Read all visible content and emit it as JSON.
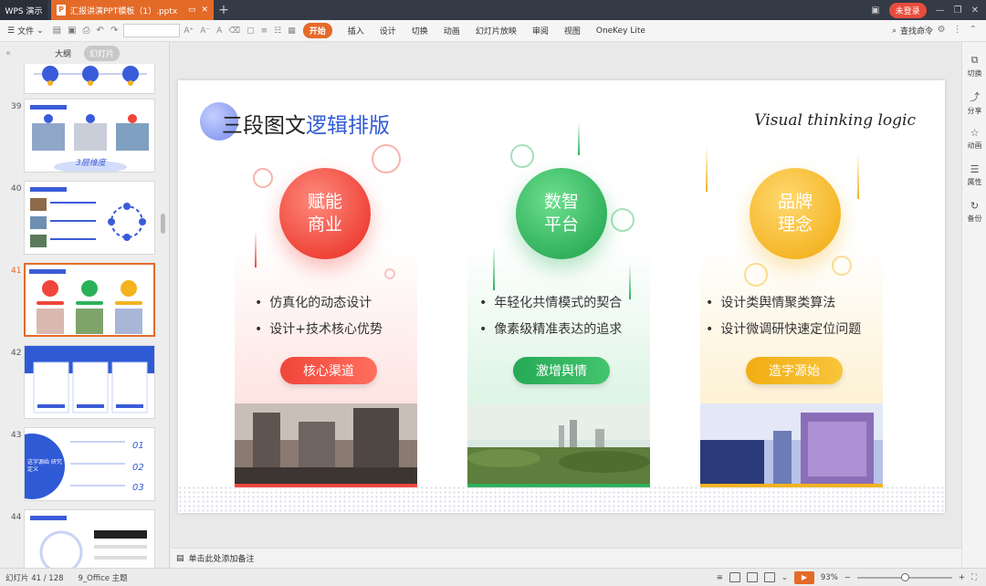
{
  "titlebar": {
    "app_name": "WPS 演示",
    "tab_name": "汇报讲演PPT模板（1）.pptx",
    "tab_badge": "P",
    "login_label": "未登录"
  },
  "toolbar": {
    "file_label": "文件",
    "ribbon_tabs": [
      "开始",
      "插入",
      "设计",
      "切换",
      "动画",
      "幻灯片放映",
      "审阅",
      "视图",
      "OneKey Lite"
    ],
    "active_tab": "开始",
    "search_label": "查找命令"
  },
  "left_panel": {
    "view_outline": "大纲",
    "view_slides": "幻灯片",
    "thumbs": [
      {
        "num": "39",
        "title_hint": "3层维度"
      },
      {
        "num": "40"
      },
      {
        "num": "41",
        "current": true
      },
      {
        "num": "42"
      },
      {
        "num": "43",
        "side_text": "这字源始 研究定义",
        "numbers": [
          "01",
          "02",
          "03"
        ]
      },
      {
        "num": "44"
      }
    ]
  },
  "slide": {
    "title_plain": "三段图文",
    "title_accent": "逻辑排版",
    "subtitle": "Visual thinking logic",
    "columns": [
      {
        "circle_line1": "赋能",
        "circle_line2": "商业",
        "bullets": [
          "仿真化的动态设计",
          "设计+技术核心优势"
        ],
        "button": "核心渠道",
        "color": "#f0453a"
      },
      {
        "circle_line1": "数智",
        "circle_line2": "平台",
        "bullets": [
          "年轻化共情模式的契合",
          "像素级精准表达的追求"
        ],
        "button": "激增舆情",
        "color": "#2bb15a"
      },
      {
        "circle_line1": "品牌",
        "circle_line2": "理念",
        "bullets": [
          "设计类舆情聚类算法",
          "设计微调研快速定位问题"
        ],
        "button": "造字源始",
        "color": "#f3b21e"
      }
    ]
  },
  "right_panel": {
    "items": [
      "切换",
      "分享",
      "动画",
      "属性",
      "备份"
    ]
  },
  "notes": {
    "placeholder": "单击此处添加备注"
  },
  "statusbar": {
    "slide_info": "幻灯片 41 / 128",
    "theme": "9_Office 主题",
    "zoom": "93%"
  }
}
